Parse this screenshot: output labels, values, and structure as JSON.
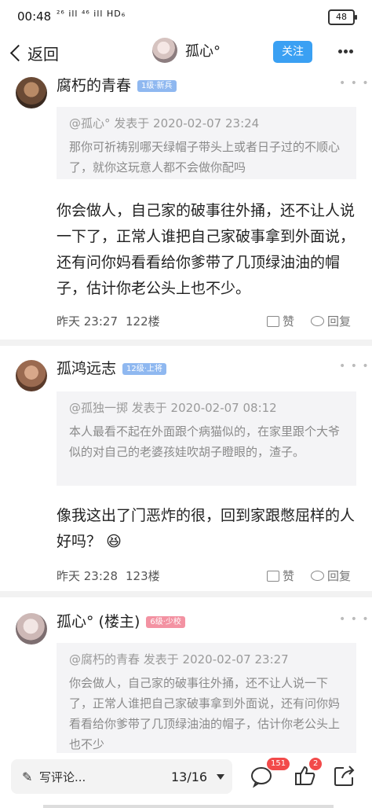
{
  "status": {
    "time": "00:48",
    "signal": "²⁶ ill ⁴⁶ ill HD₆",
    "battery": "48"
  },
  "header": {
    "back": "返回",
    "username": "孤心°",
    "follow": "关注"
  },
  "posts": [
    {
      "name": "腐朽的青春",
      "level": "1级·新兵",
      "quote_header": "@孤心° 发表于 2020-02-07 23:24",
      "quote_text": "那你可祈祷别哪天绿帽子带头上或者日子过的不顺心了，就你这玩意人都不会做你配吗",
      "body": "你会做人，自己家的破事往外捅，还不让人说一下了，正常人谁把自己家破事拿到外面说，还有问你妈看看给你爹带了几顶绿油油的帽子，估计你老公头上也不少。",
      "time": "昨天 23:27",
      "floor": "122楼",
      "like": "赞",
      "reply": "回复"
    },
    {
      "name": "孤鸿远志",
      "level": "12级·上将",
      "quote_header": "@孤独一掷 发表于 2020-02-07 08:12",
      "quote_text": "本人最看不起在外面跟个病猫似的，在家里跟个大爷似的对自己的老婆孩娃吹胡子瞪眼的，渣子。",
      "body": "像我这出了门恶炸的很，回到家跟憋屈样的人好吗？",
      "emoji": "😆",
      "time": "昨天 23:28",
      "floor": "123楼",
      "like": "赞",
      "reply": "回复"
    },
    {
      "name": "孤心° (楼主)",
      "level": "6级·少校",
      "quote_header": "@腐朽的青春 发表于 2020-02-07 23:27",
      "quote_text": "你会做人，自己家的破事往外捅，还不让人说一下了，正常人谁把自己家破事拿到外面说，还有问你妈看看给你爹带了几顶绿油油的帽子，估计你老公头上也不少"
    }
  ],
  "bottom": {
    "write_comment": "写评论...",
    "page": "13/16",
    "comment_count": "151",
    "like_count": "2"
  }
}
